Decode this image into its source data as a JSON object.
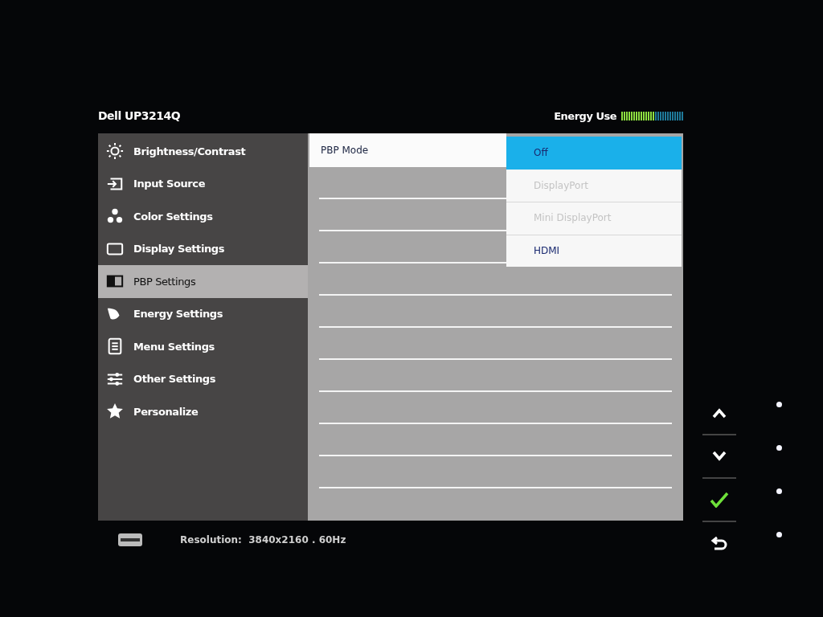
{
  "title": "Dell UP3214Q",
  "energy_use": {
    "label": "Energy Use",
    "level": 0.52
  },
  "menu": [
    {
      "label": "Brightness/Contrast",
      "selected": false
    },
    {
      "label": "Input Source",
      "selected": false
    },
    {
      "label": "Color Settings",
      "selected": false
    },
    {
      "label": "Display Settings",
      "selected": false
    },
    {
      "label": "PBP Settings",
      "selected": true
    },
    {
      "label": "Energy Settings",
      "selected": false
    },
    {
      "label": "Menu Settings",
      "selected": false
    },
    {
      "label": "Other Settings",
      "selected": false
    },
    {
      "label": "Personalize",
      "selected": false
    }
  ],
  "settings": [
    {
      "label": "PBP Mode",
      "selected": true
    }
  ],
  "options": [
    {
      "label": "Off",
      "selected": true,
      "disabled": false
    },
    {
      "label": "DisplayPort",
      "selected": false,
      "disabled": true
    },
    {
      "label": "Mini DisplayPort",
      "selected": false,
      "disabled": true
    },
    {
      "label": "HDMI",
      "selected": false,
      "disabled": false
    }
  ],
  "status_bar": {
    "resolution": "Resolution:  3840x2160 . 60Hz"
  }
}
